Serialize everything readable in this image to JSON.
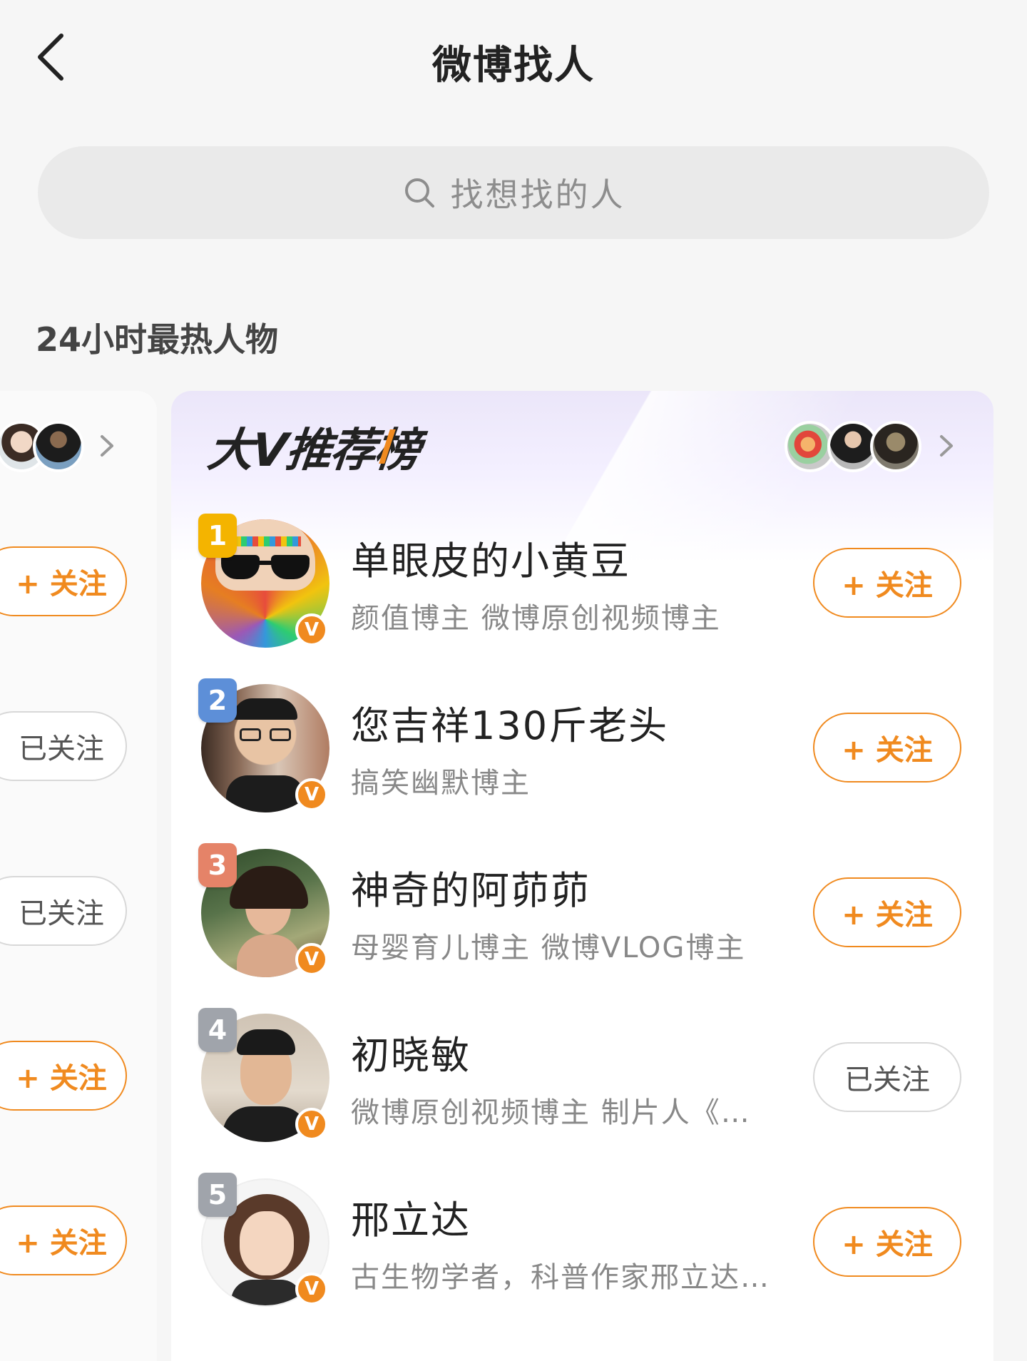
{
  "header": {
    "title": "微博找人",
    "back_icon": "chevron-left-icon"
  },
  "search": {
    "placeholder": "找想找的人",
    "icon": "search-icon"
  },
  "section": {
    "title": "24小时最热人物"
  },
  "side_buttons": [
    {
      "label": "+ 关注",
      "state": "follow"
    },
    {
      "label": "已关注",
      "state": "followed"
    },
    {
      "label": "已关注",
      "state": "followed"
    },
    {
      "label": "+ 关注",
      "state": "follow"
    },
    {
      "label": "+ 关注",
      "state": "follow"
    }
  ],
  "card": {
    "title": "大V推荐榜",
    "more_icon": "chevron-right-icon"
  },
  "rows": [
    {
      "rank": "1",
      "name": "单眼皮的小黄豆",
      "desc": "颜值博主 微博原创视频博主",
      "button": "+ 关注",
      "state": "follow"
    },
    {
      "rank": "2",
      "name": "您吉祥130斤老头",
      "desc": "搞笑幽默博主",
      "button": "+ 关注",
      "state": "follow"
    },
    {
      "rank": "3",
      "name": "神奇的阿茆茆",
      "desc": "母婴育儿博主 微博VLOG博主",
      "button": "+ 关注",
      "state": "follow"
    },
    {
      "rank": "4",
      "name": "初晓敏",
      "desc": "微博原创视频博主 制片人《车…",
      "button": "已关注",
      "state": "followed"
    },
    {
      "rank": "5",
      "name": "邢立达",
      "desc": "古生物学者，科普作家邢立达 …",
      "button": "+ 关注",
      "state": "follow"
    }
  ],
  "colors": {
    "accent": "#f08a1f",
    "verified": "#f08a1f",
    "rank1": "#f4b400",
    "rank2": "#5d8fd8",
    "rank3": "#e58368",
    "rank_other": "#a0a4ab"
  }
}
